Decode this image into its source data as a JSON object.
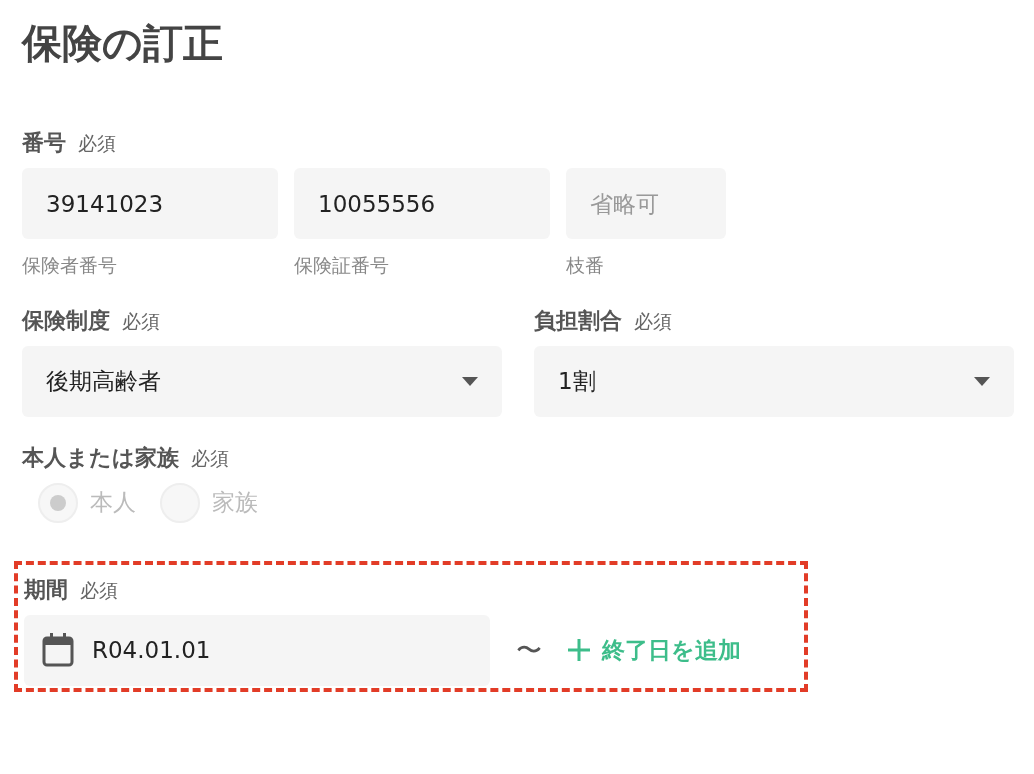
{
  "title": "保険の訂正",
  "number": {
    "label": "番号",
    "required": "必須",
    "fields": [
      {
        "value": "39141023",
        "caption": "保険者番号"
      },
      {
        "value": "10055556",
        "caption": "保険証番号"
      },
      {
        "placeholder": "省略可",
        "caption": "枝番"
      }
    ]
  },
  "insurance_system": {
    "label": "保険制度",
    "required": "必須",
    "value": "後期高齢者"
  },
  "burden_ratio": {
    "label": "負担割合",
    "required": "必須",
    "value": "1割"
  },
  "relation": {
    "label": "本人または家族",
    "required": "必須",
    "disabled": true,
    "options": [
      {
        "label": "本人",
        "selected": true
      },
      {
        "label": "家族",
        "selected": false
      }
    ]
  },
  "period": {
    "label": "期間",
    "required": "必須",
    "highlighted": true,
    "start": "R04.01.01",
    "separator": "〜",
    "add_end_button": "終了日を追加"
  }
}
